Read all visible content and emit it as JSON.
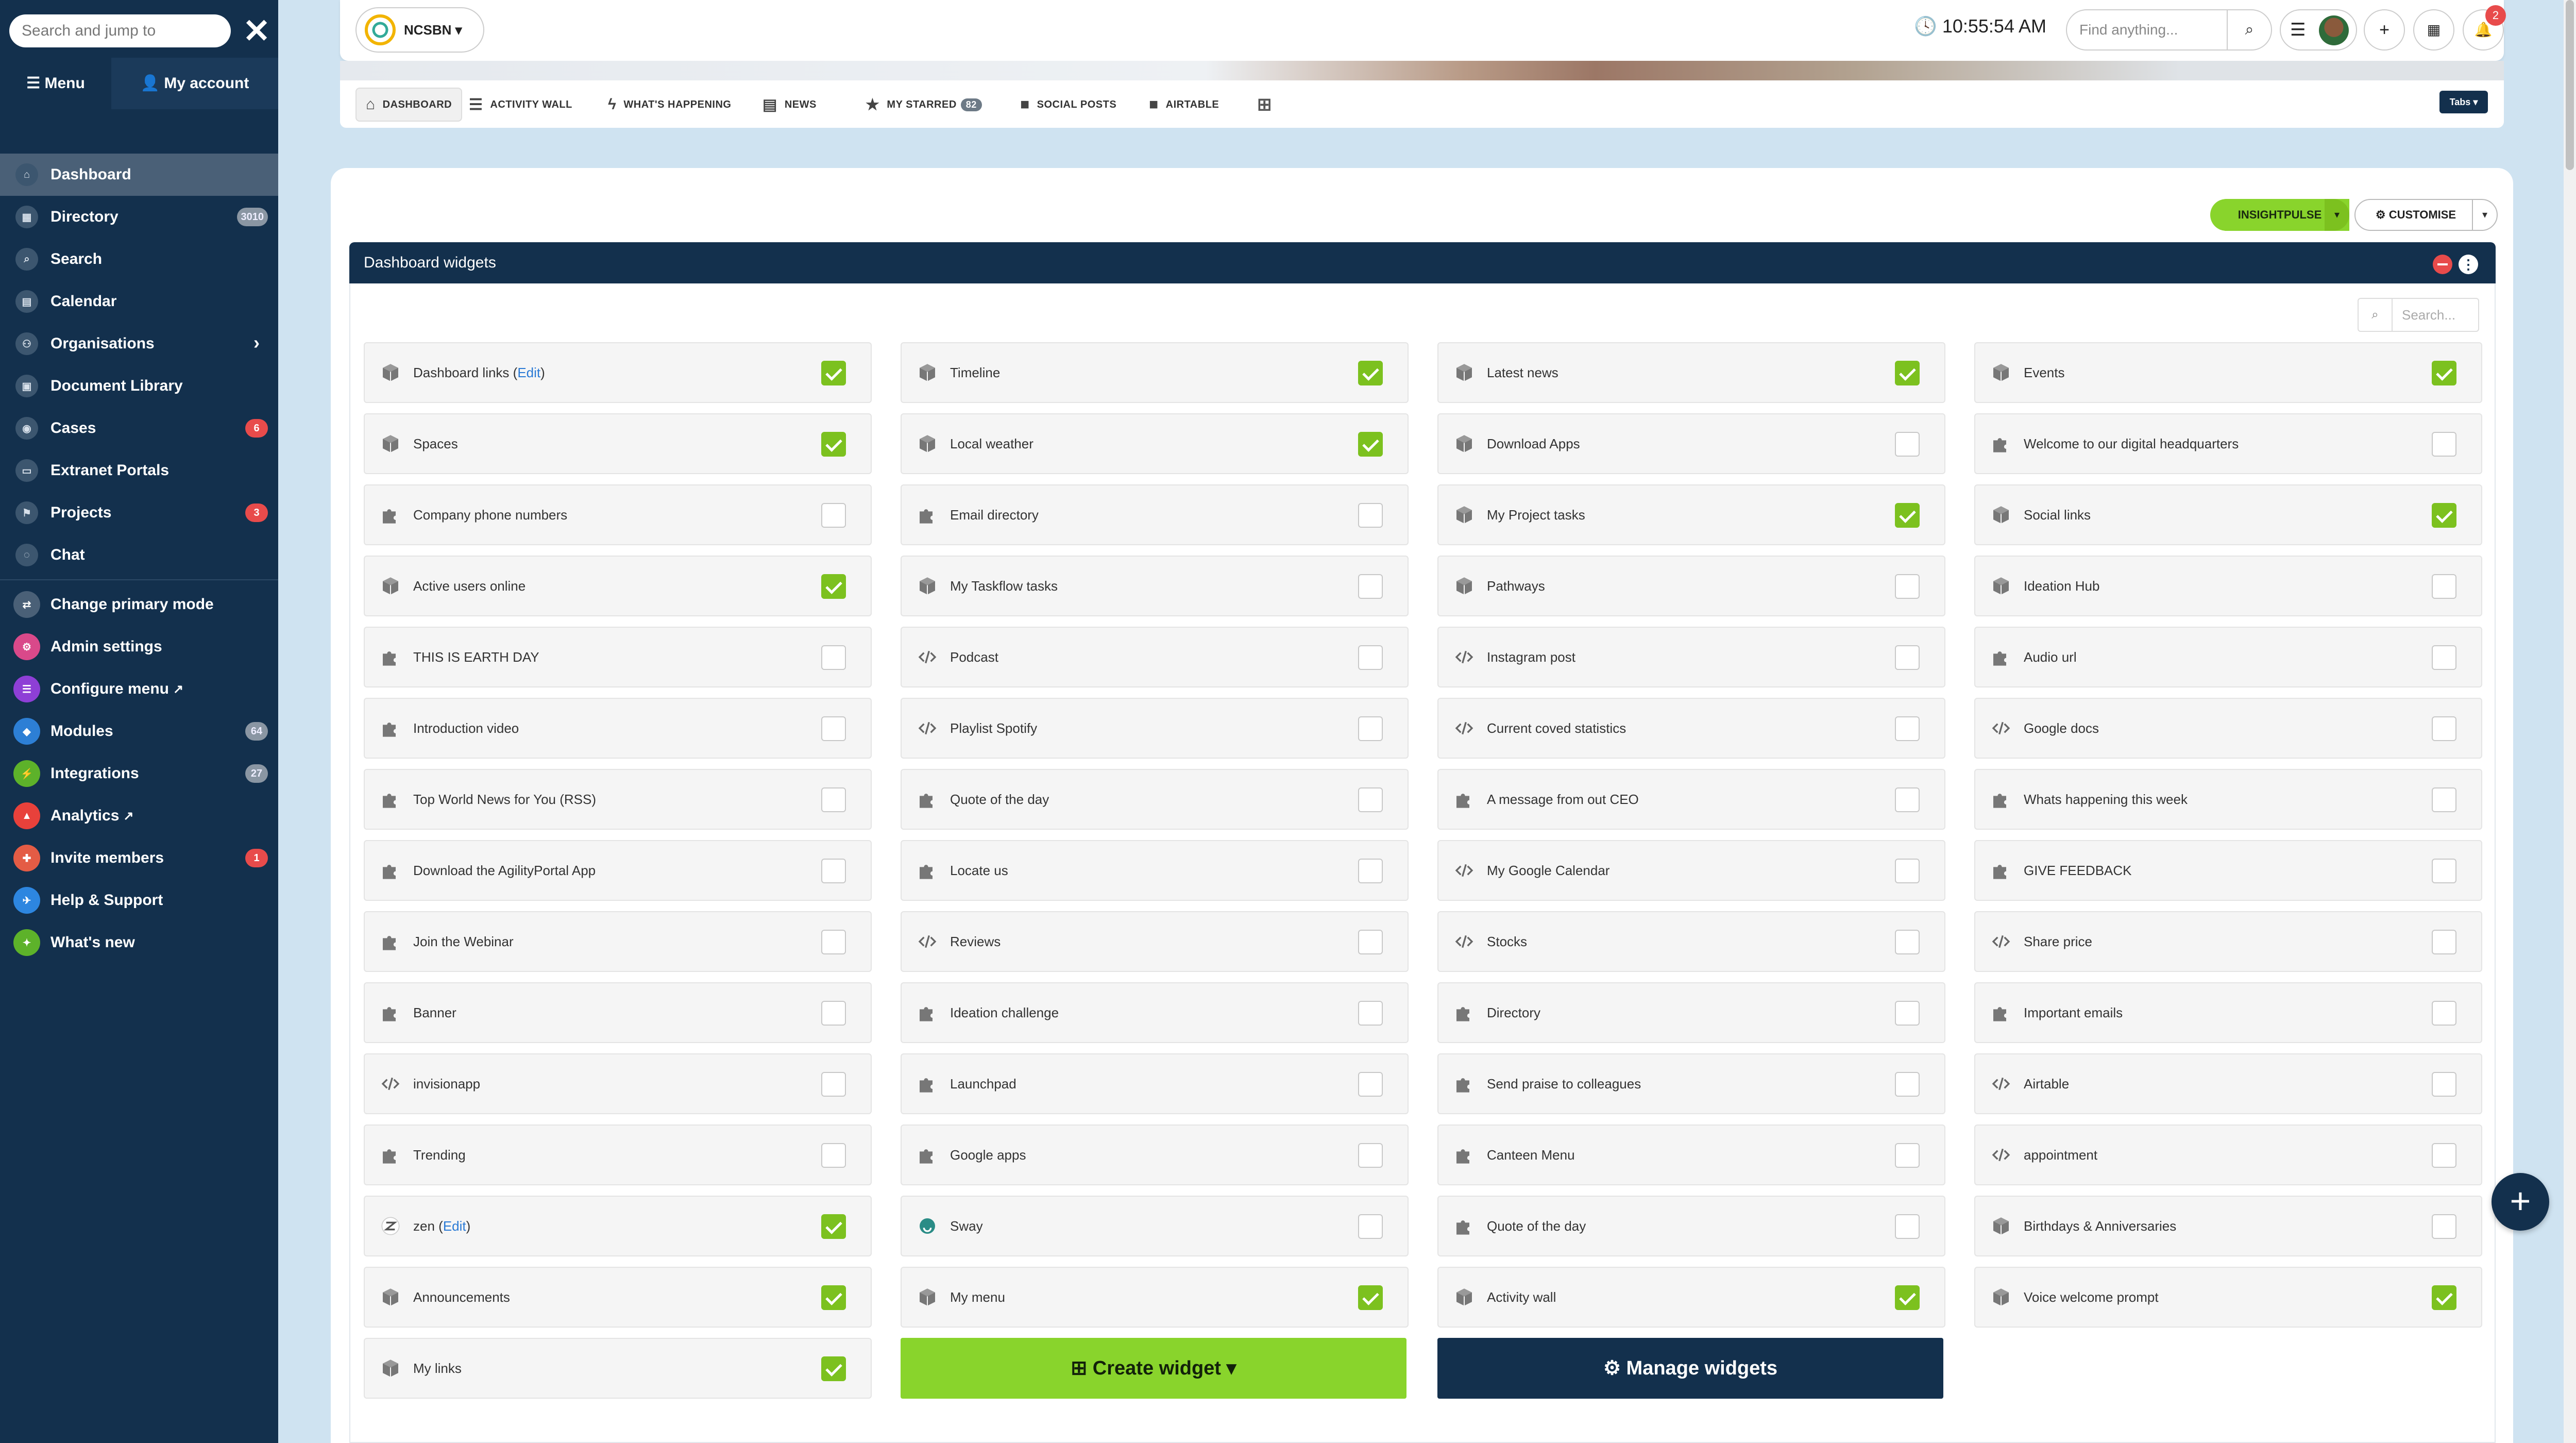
{
  "sidebar": {
    "search_placeholder": "Search and jump to",
    "close_label": "✕",
    "menu_label": "☰ Menu",
    "account_label": "My account",
    "items": [
      {
        "label": "Dashboard",
        "icon": "home-icon",
        "glyph": "⌂",
        "active": true
      },
      {
        "label": "Directory",
        "icon": "directory-icon",
        "glyph": "▦",
        "badge": "3010",
        "badge_color": "grey"
      },
      {
        "label": "Search",
        "icon": "search-icon",
        "glyph": "⌕"
      },
      {
        "label": "Calendar",
        "icon": "calendar-icon",
        "glyph": "▤"
      },
      {
        "label": "Organisations",
        "icon": "organisations-icon",
        "glyph": "⚇",
        "chevron": true
      },
      {
        "label": "Document Library",
        "icon": "document-icon",
        "glyph": "▣"
      },
      {
        "label": "Cases",
        "icon": "cases-icon",
        "glyph": "◉",
        "badge": "6",
        "badge_color": "red"
      },
      {
        "label": "Extranet Portals",
        "icon": "portal-icon",
        "glyph": "▭"
      },
      {
        "label": "Projects",
        "icon": "projects-icon",
        "glyph": "⚑",
        "badge": "3",
        "badge_color": "red"
      },
      {
        "label": "Chat",
        "icon": "chat-icon",
        "glyph": "◌"
      }
    ],
    "admin_items": [
      {
        "label": "Change primary mode",
        "icon": "switch-icon",
        "glyph": "⇄",
        "color": "#4a6077"
      },
      {
        "label": "Admin settings",
        "icon": "admin-settings-icon",
        "glyph": "⚙",
        "color": "#d9498a"
      },
      {
        "label": "Configure menu",
        "icon": "configure-menu-icon",
        "glyph": "☰",
        "color": "#8e3fd6",
        "suffix": "↗"
      },
      {
        "label": "Modules",
        "icon": "modules-icon",
        "glyph": "◆",
        "color": "#2d7fd5",
        "badge": "64",
        "badge_color": "grey"
      },
      {
        "label": "Integrations",
        "icon": "integrations-icon",
        "glyph": "⚡",
        "color": "#5db22a",
        "badge": "27",
        "badge_color": "grey"
      },
      {
        "label": "Analytics",
        "icon": "analytics-icon",
        "glyph": "▲",
        "color": "#e8413b",
        "suffix": "↗"
      },
      {
        "label": "Invite members",
        "icon": "invite-icon",
        "glyph": "✚",
        "color": "#e45c45",
        "badge": "1",
        "badge_color": "red"
      },
      {
        "label": "Help & Support",
        "icon": "help-icon",
        "glyph": "✈",
        "color": "#2d86e0"
      },
      {
        "label": "What's new",
        "icon": "whats-new-icon",
        "glyph": "✦",
        "color": "#5db22a"
      }
    ]
  },
  "topbar": {
    "org_name": "NCSBN ▾",
    "clock": "🕓 10:55:54 AM",
    "find_placeholder": "Find anything...",
    "find_icon": "⌕",
    "menu_icon": "☰",
    "add_icon": "+",
    "calendar_icon": "▦",
    "bell_icon": "🔔",
    "notifications": "2"
  },
  "tabs": [
    {
      "label": "DASHBOARD",
      "glyph": "⌂",
      "active": true,
      "name": "tab-dashboard"
    },
    {
      "label": "ACTIVITY WALL",
      "glyph": "☰",
      "name": "tab-activity-wall"
    },
    {
      "label": "WHAT'S HAPPENING",
      "glyph": "ϟ",
      "name": "tab-whats-happening"
    },
    {
      "label": "NEWS",
      "glyph": "▤",
      "name": "tab-news"
    },
    {
      "label": "MY STARRED",
      "glyph": "★",
      "count": "82",
      "name": "tab-my-starred"
    },
    {
      "label": "SOCIAL POSTS",
      "glyph": "■",
      "name": "tab-social-posts"
    },
    {
      "label": "AIRTABLE",
      "glyph": "■",
      "name": "tab-airtable"
    }
  ],
  "tabs_add_glyph": "⊞",
  "tabs_dropdown": "Tabs ▾",
  "actions": {
    "insight": "INSIGHTPULSE",
    "insight_dd": "▾",
    "customise": "⚙ CUSTOMISE",
    "customise_dd": "▾"
  },
  "panel": {
    "title": "Dashboard widgets",
    "more": "⋮",
    "search_placeholder": "Search...",
    "search_icon": "⌕"
  },
  "widgets": [
    [
      {
        "label": "Dashboard links",
        "edit": "Edit",
        "icon": "cube",
        "checked": true
      },
      {
        "label": "Spaces",
        "icon": "cube",
        "checked": true
      },
      {
        "label": "Company phone numbers",
        "icon": "puzzle",
        "checked": false
      },
      {
        "label": "Active users online",
        "icon": "cube",
        "checked": true
      },
      {
        "label": "THIS IS EARTH DAY",
        "icon": "puzzle",
        "checked": false
      },
      {
        "label": "Introduction video",
        "icon": "puzzle",
        "checked": false
      },
      {
        "label": "Top World News for You (RSS)",
        "icon": "puzzle",
        "checked": false
      },
      {
        "label": "Download the AgilityPortal App",
        "icon": "puzzle",
        "checked": false
      },
      {
        "label": "Join the Webinar",
        "icon": "puzzle",
        "checked": false
      },
      {
        "label": "Banner",
        "icon": "puzzle",
        "checked": false
      },
      {
        "label": "invisionapp",
        "icon": "code",
        "checked": false
      },
      {
        "label": "Trending",
        "icon": "puzzle",
        "checked": false
      },
      {
        "label": "zen",
        "edit": "Edit",
        "icon": "zen",
        "checked": true
      },
      {
        "label": "Announcements",
        "icon": "cube",
        "checked": true
      },
      {
        "label": "My links",
        "icon": "cube",
        "checked": true
      }
    ],
    [
      {
        "label": "Timeline",
        "icon": "cube",
        "checked": true
      },
      {
        "label": "Local weather",
        "icon": "cube",
        "checked": true
      },
      {
        "label": "Email directory",
        "icon": "puzzle",
        "checked": false
      },
      {
        "label": "My Taskflow tasks",
        "icon": "cube",
        "checked": false
      },
      {
        "label": "Podcast",
        "icon": "code",
        "checked": false
      },
      {
        "label": "Playlist Spotify",
        "icon": "code",
        "checked": false
      },
      {
        "label": "Quote of the day",
        "icon": "puzzle",
        "checked": false
      },
      {
        "label": "Locate us",
        "icon": "puzzle",
        "checked": false
      },
      {
        "label": "Reviews",
        "icon": "code",
        "checked": false
      },
      {
        "label": "Ideation challenge",
        "icon": "puzzle",
        "checked": false
      },
      {
        "label": "Launchpad",
        "icon": "puzzle",
        "checked": false
      },
      {
        "label": "Google apps",
        "icon": "puzzle",
        "checked": false
      },
      {
        "label": "Sway",
        "icon": "sway",
        "checked": false
      },
      {
        "label": "My menu",
        "icon": "cube",
        "checked": true
      }
    ],
    [
      {
        "label": "Latest news",
        "icon": "cube",
        "checked": true
      },
      {
        "label": "Download Apps",
        "icon": "cube",
        "checked": false
      },
      {
        "label": "My Project tasks",
        "icon": "cube",
        "checked": true
      },
      {
        "label": "Pathways",
        "icon": "cube",
        "checked": false
      },
      {
        "label": "Instagram post",
        "icon": "code",
        "checked": false
      },
      {
        "label": "Current coved statistics",
        "icon": "code",
        "checked": false
      },
      {
        "label": "A message from out CEO",
        "icon": "puzzle",
        "checked": false
      },
      {
        "label": "My Google Calendar",
        "icon": "code",
        "checked": false
      },
      {
        "label": "Stocks",
        "icon": "code",
        "checked": false
      },
      {
        "label": "Directory",
        "icon": "puzzle",
        "checked": false
      },
      {
        "label": "Send praise to colleagues",
        "icon": "puzzle",
        "checked": false
      },
      {
        "label": "Canteen Menu",
        "icon": "puzzle",
        "checked": false
      },
      {
        "label": "Quote of the day",
        "icon": "puzzle",
        "checked": false
      },
      {
        "label": "Activity wall",
        "icon": "cube",
        "checked": true
      }
    ],
    [
      {
        "label": "Events",
        "icon": "cube",
        "checked": true
      },
      {
        "label": "Welcome to our digital headquarters",
        "icon": "puzzle",
        "checked": false
      },
      {
        "label": "Social links",
        "icon": "cube",
        "checked": true
      },
      {
        "label": "Ideation Hub",
        "icon": "cube",
        "checked": false
      },
      {
        "label": "Audio url",
        "icon": "puzzle",
        "checked": false
      },
      {
        "label": "Google docs",
        "icon": "code",
        "checked": false
      },
      {
        "label": "Whats happening this week",
        "icon": "puzzle",
        "checked": false
      },
      {
        "label": "GIVE FEEDBACK",
        "icon": "puzzle",
        "checked": false
      },
      {
        "label": "Share price",
        "icon": "code",
        "checked": false
      },
      {
        "label": "Important emails",
        "icon": "puzzle",
        "checked": false
      },
      {
        "label": "Airtable",
        "icon": "code",
        "checked": false
      },
      {
        "label": "appointment",
        "icon": "code",
        "checked": false
      },
      {
        "label": "Birthdays & Anniversaries",
        "icon": "cube",
        "checked": false
      },
      {
        "label": "Voice welcome prompt",
        "icon": "cube",
        "checked": true
      }
    ]
  ],
  "buttons": {
    "create": "⊞ Create widget ▾",
    "manage": "⚙ Manage widgets"
  },
  "fab": "+"
}
